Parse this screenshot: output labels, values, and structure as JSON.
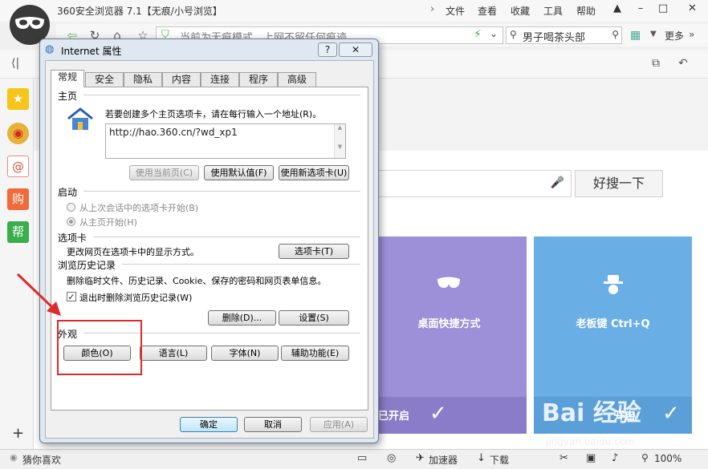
{
  "browser": {
    "title": "360安全浏览器 7.1【无痕/小号浏览】",
    "menu": [
      "文件",
      "查看",
      "收藏",
      "工具",
      "帮助"
    ],
    "address_hint": "当前为无痕模式，上网不留任何痕迹",
    "search_text": "男子喝茶头部",
    "more_label": "更多",
    "search_button": "好搜一下",
    "cards": [
      {
        "label": "桌面快捷方式",
        "state": "已开启",
        "color": "#9d8fd8"
      },
      {
        "label": "老板键 Ctrl+Q",
        "state": "开启",
        "color": "#6aaee6"
      }
    ],
    "status": {
      "guess": "猜你喜欢",
      "accelerator": "加速器",
      "download": "下载",
      "zoom": "100%"
    },
    "sidebar_icons": [
      "star-icon",
      "weibo-icon",
      "mail-icon",
      "shopping-icon",
      "help-icon"
    ],
    "sidebar_help_label": "帮"
  },
  "dialog": {
    "title": "Internet 属性",
    "help": "?",
    "tabs": [
      "常规",
      "安全",
      "隐私",
      "内容",
      "连接",
      "程序",
      "高级"
    ],
    "active_tab": "常规",
    "homepage": {
      "heading": "主页",
      "desc": "若要创建多个主页选项卡，请在每行输入一个地址(R)。",
      "url": "http://hao.360.cn/?wd_xp1",
      "btn_current": "使用当前页(C)",
      "btn_default": "使用默认值(F)",
      "btn_newtab": "使用新选项卡(U)"
    },
    "startup": {
      "heading": "启动",
      "opt1": "从上次会话中的选项卡开始(B)",
      "opt2": "从主页开始(H)"
    },
    "tabs_section": {
      "heading": "选项卡",
      "desc": "更改网页在选项卡中的显示方式。",
      "btn": "选项卡(T)"
    },
    "history": {
      "heading": "浏览历史记录",
      "desc": "删除临时文件、历史记录、Cookie、保存的密码和网页表单信息。",
      "checkbox": "退出时删除浏览历史记录(W)",
      "btn_delete": "删除(D)...",
      "btn_settings": "设置(S)"
    },
    "appearance": {
      "heading": "外观",
      "btn_colors": "颜色(O)",
      "btn_languages": "语言(L)",
      "btn_fonts": "字体(N)",
      "btn_accessibility": "辅助功能(E)"
    },
    "footer": {
      "ok": "确定",
      "cancel": "取消",
      "apply": "应用(A)"
    }
  },
  "watermark": {
    "text": "Bai 经验",
    "sub": "jingyan.baidu.com"
  },
  "colors": {
    "highlight": "#e02a2a",
    "purple_card": "#9d8fd8",
    "blue_card": "#6aaee6"
  }
}
